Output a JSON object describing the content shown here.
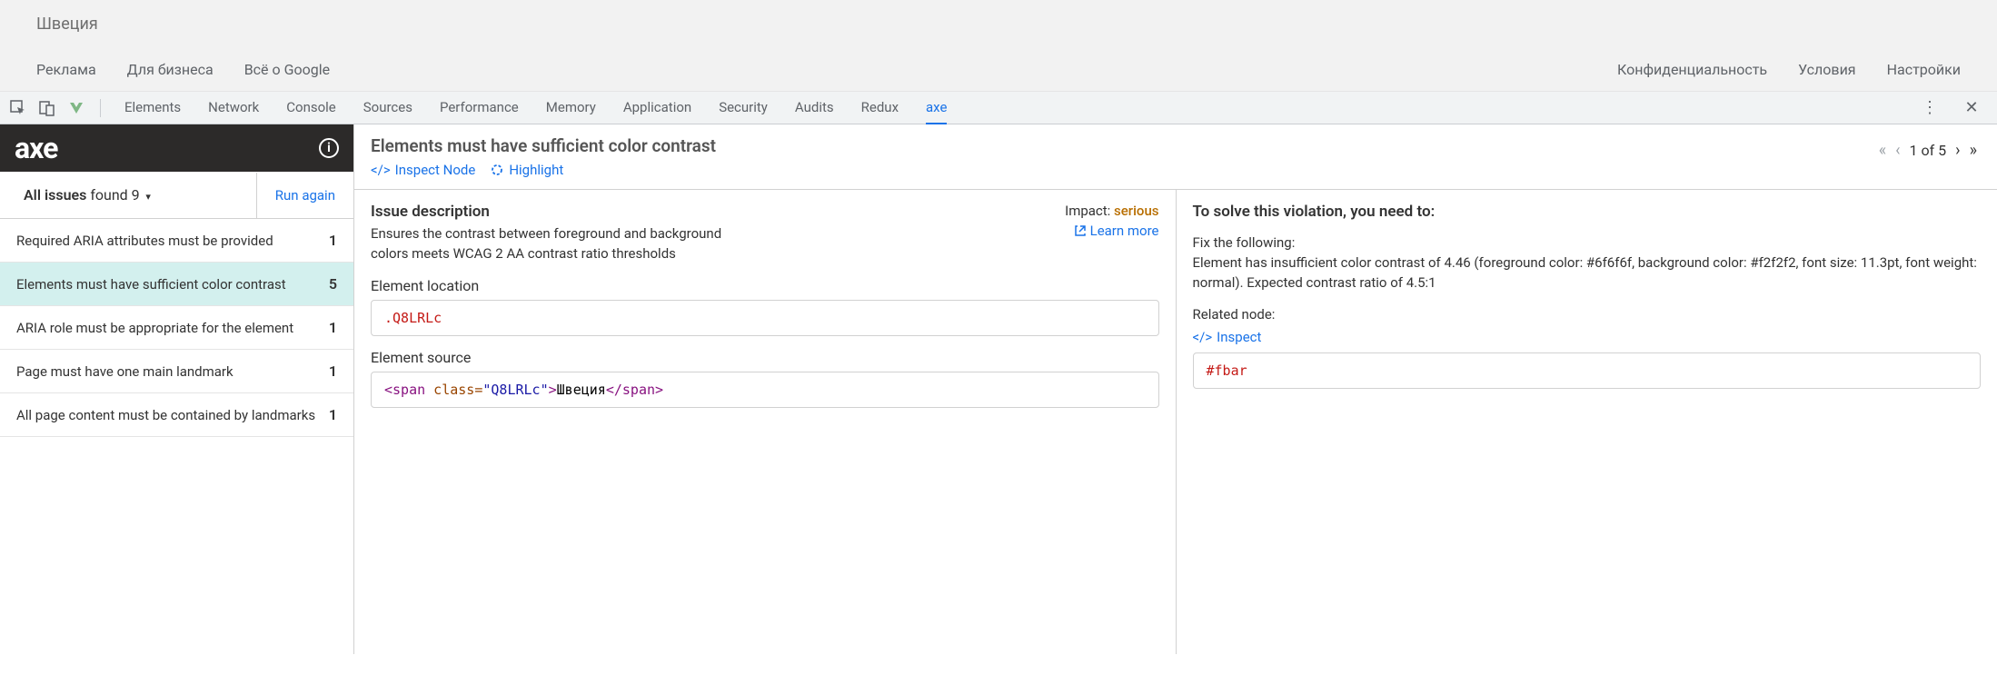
{
  "page": {
    "location": "Швеция",
    "footer_left": [
      "Реклама",
      "Для бизнеса",
      "Всё о Google"
    ],
    "footer_right": [
      "Конфиденциальность",
      "Условия",
      "Настройки"
    ]
  },
  "devtools": {
    "tabs": [
      "Elements",
      "Network",
      "Console",
      "Sources",
      "Performance",
      "Memory",
      "Application",
      "Security",
      "Audits",
      "Redux",
      "axe"
    ],
    "active_tab": "axe"
  },
  "axe": {
    "logo": "axe",
    "issues_bold": "All issues",
    "issues_rest": " found 9",
    "run_again": "Run again",
    "issues": [
      {
        "title": "Required ARIA attributes must be provided",
        "count": "1"
      },
      {
        "title": "Elements must have sufficient color contrast",
        "count": "5"
      },
      {
        "title": "ARIA role must be appropriate for the element",
        "count": "1"
      },
      {
        "title": "Page must have one main landmark",
        "count": "1"
      },
      {
        "title": "All page content must be contained by landmarks",
        "count": "1"
      }
    ],
    "selected_index": 1,
    "detail": {
      "title": "Elements must have sufficient color contrast",
      "inspect_node": "Inspect Node",
      "highlight": "Highlight",
      "pager": "1 of 5",
      "desc_heading": "Issue description",
      "desc_text": "Ensures the contrast between foreground and background colors meets WCAG 2 AA contrast ratio thresholds",
      "impact_label": "Impact: ",
      "impact_value": "serious",
      "learn_more": "Learn more",
      "loc_heading": "Element location",
      "loc_code": ".Q8LRLc",
      "src_heading": "Element source",
      "src_code_parts": {
        "open": "<span",
        "attr": " class=",
        "val": "\"Q8LRLc\"",
        "gt": ">",
        "text": "Швеция",
        "close": "</span>"
      },
      "solve_heading": "To solve this violation, you need to:",
      "fix_heading": "Fix the following:",
      "fix_text": "Element has insufficient color contrast of 4.46 (foreground color: #6f6f6f, background color: #f2f2f2, font size: 11.3pt, font weight: normal). Expected contrast ratio of 4.5:1",
      "related_heading": "Related node:",
      "inspect": "Inspect",
      "related_code": "#fbar"
    }
  }
}
